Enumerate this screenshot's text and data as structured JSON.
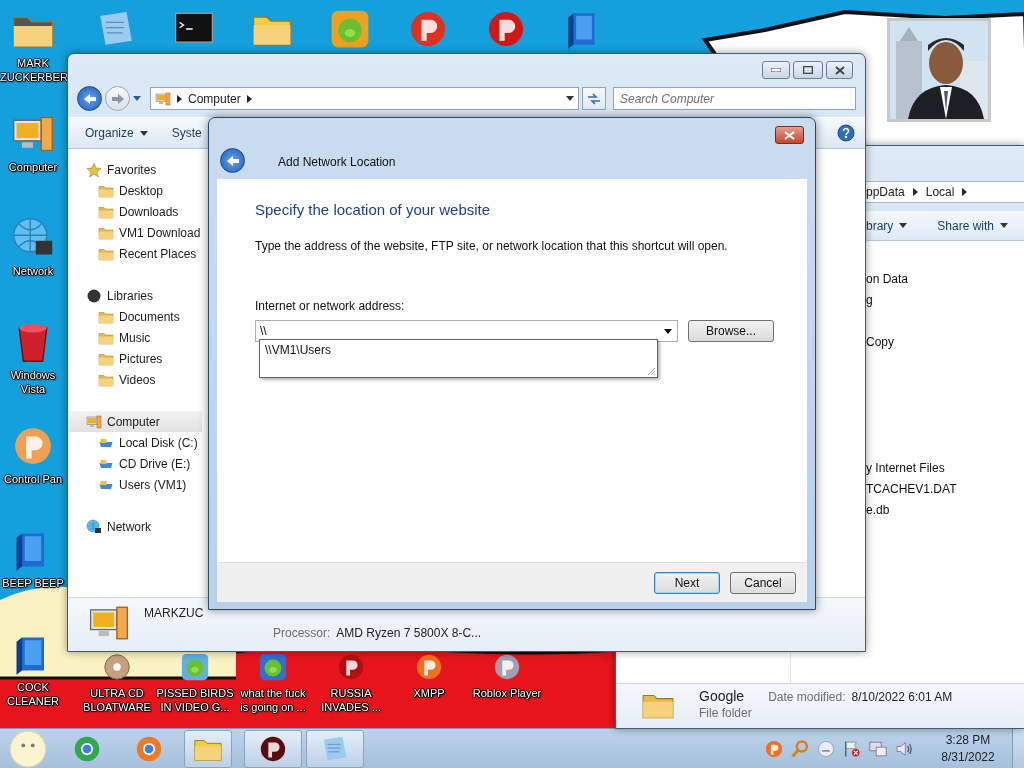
{
  "desktop": {
    "left_icons": [
      {
        "label": "MARK ZUCKERBER"
      },
      {
        "label": "Computer"
      },
      {
        "label": "Network"
      },
      {
        "label": "Windows Vista"
      },
      {
        "label": "Control Pan"
      },
      {
        "label": "BEEP BEEP"
      },
      {
        "label": "COCK CLEANER"
      }
    ],
    "bottom_icons": [
      {
        "label": "ULTRA CD BLOATWARE"
      },
      {
        "label": "PISSED BIRDS IN VIDEO G..."
      },
      {
        "label": "what the fuck is going on ..."
      },
      {
        "label": "RUSSIA INVADES ..."
      },
      {
        "label": "XMPP"
      },
      {
        "label": "Roblox Player"
      }
    ]
  },
  "back_window": {
    "breadcrumb": [
      "ppData",
      "Local"
    ],
    "toolbar": [
      {
        "label": "brary",
        "menu": true
      },
      {
        "label": "Share with",
        "menu": true
      }
    ],
    "groups": [
      [
        "on Data",
        "g"
      ],
      [
        "Copy"
      ],
      [
        "y Internet Files",
        "TCACHEV1.DAT",
        "e.db"
      ]
    ],
    "details": {
      "name": "Google",
      "date_label": "Date modified:",
      "date": "8/10/2022 6:01 AM",
      "type": "File folder"
    }
  },
  "explorer": {
    "breadcrumb": [
      "Computer"
    ],
    "search": {
      "placeholder": "Search Computer"
    },
    "toolbar": [
      {
        "label": "Organize",
        "menu": true
      },
      {
        "label": "Syste",
        "menu": false
      }
    ],
    "nav": [
      {
        "label": "Favorites",
        "selected": false,
        "children": [
          {
            "label": "Desktop",
            "selected": false
          },
          {
            "label": "Downloads",
            "selected": false
          },
          {
            "label": "VM1 Download",
            "selected": false
          },
          {
            "label": "Recent Places",
            "selected": false
          }
        ]
      },
      {
        "label": "Libraries",
        "selected": false,
        "children": [
          {
            "label": "Documents",
            "selected": false
          },
          {
            "label": "Music",
            "selected": false
          },
          {
            "label": "Pictures",
            "selected": false
          },
          {
            "label": "Videos",
            "selected": false
          }
        ]
      },
      {
        "label": "Computer",
        "selected": true,
        "children": [
          {
            "label": "Local Disk (C:)",
            "selected": false
          },
          {
            "label": "CD Drive (E:)",
            "selected": false
          },
          {
            "label": "Users (VM1)",
            "selected": false
          }
        ]
      },
      {
        "label": "Network",
        "selected": false
      }
    ],
    "details": {
      "name": "MARKZUC",
      "processor_label": "Processor:",
      "processor": "AMD Ryzen 7 5800X 8-C..."
    }
  },
  "dialog": {
    "title": "Add Network Location",
    "heading": "Specify the location of your website",
    "description": "Type the address of the website, FTP site, or network location that this shortcut will open.",
    "address": {
      "label": "Internet or network address:",
      "value": "\\\\"
    },
    "suggestions": [
      "\\\\VM1\\Users"
    ],
    "browse": "Browse...",
    "buttons": [
      {
        "label": "Next",
        "default": true
      },
      {
        "label": "Cancel",
        "default": false
      }
    ]
  },
  "taskbar": {
    "clock": {
      "time": "3:28 PM",
      "date": "8/31/2022"
    }
  }
}
